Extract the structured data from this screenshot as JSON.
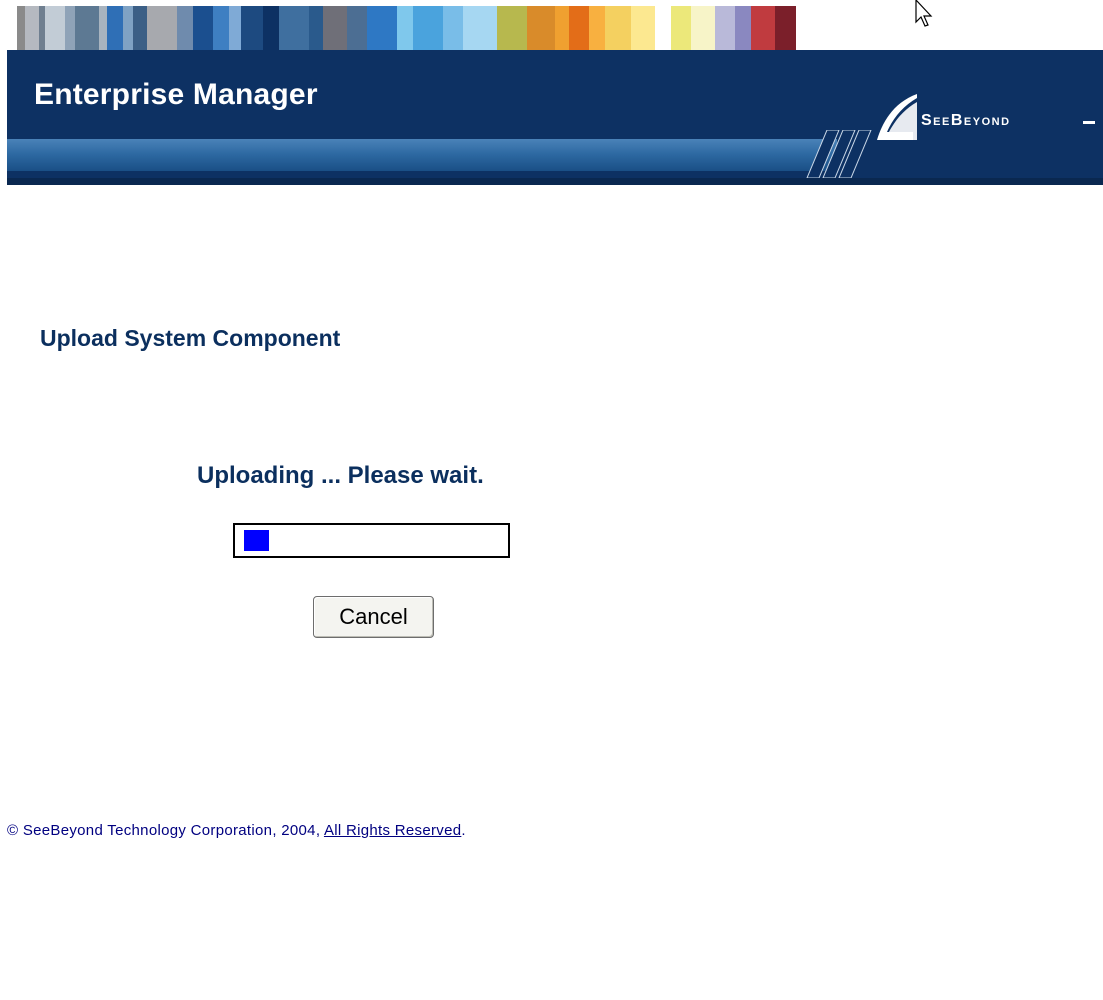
{
  "header": {
    "app_title": "Enterprise Manager",
    "logo_text": "SeeBeyond",
    "background_color": "#0d3163",
    "stripe_colors": [
      "#ffffff",
      "#8a8a8a",
      "#b5b9c0",
      "#6f7f90",
      "#c2ccd6",
      "#8fa3b8",
      "#5d7993",
      "#a9b4bf",
      "#2f6fb6",
      "#7fa2c4",
      "#3b5f86",
      "#a7a9ae",
      "#6f8bad",
      "#1b4f8f",
      "#3e7fc2",
      "#7faad6",
      "#1d4a80",
      "#0d3163",
      "#3f6f9f",
      "#2a5a8c",
      "#6f6f78",
      "#4c6e93",
      "#2e78c4",
      "#7fc8ec",
      "#4aa3dd",
      "#79bde8",
      "#a6d7f2",
      "#b7b84e",
      "#d98b2a",
      "#f0a030",
      "#e36d18",
      "#f8b040",
      "#f4d060",
      "#fce890",
      "#ffffff",
      "#ece87a",
      "#f7f4c8",
      "#b9b9d9",
      "#8a88c0",
      "#c03b3f",
      "#7b1f2a"
    ]
  },
  "page": {
    "title": "Upload System Component"
  },
  "upload": {
    "status_message": "Uploading ... Please wait.",
    "progress_fraction": 0.03,
    "progress_color": "#0000ff",
    "cancel_label": "Cancel"
  },
  "footer": {
    "copyright_symbol": "©",
    "copyright_text": "SeeBeyond Technology Corporation, 2004,",
    "link_text": "All Rights Reserved",
    "trailing": "."
  },
  "colors": {
    "title_text": "#0b2f5e",
    "footer_text": "#000080"
  },
  "icons": {
    "cursor": "mouse-pointer-icon",
    "logo_mark": "seebeyond-logo-icon"
  }
}
